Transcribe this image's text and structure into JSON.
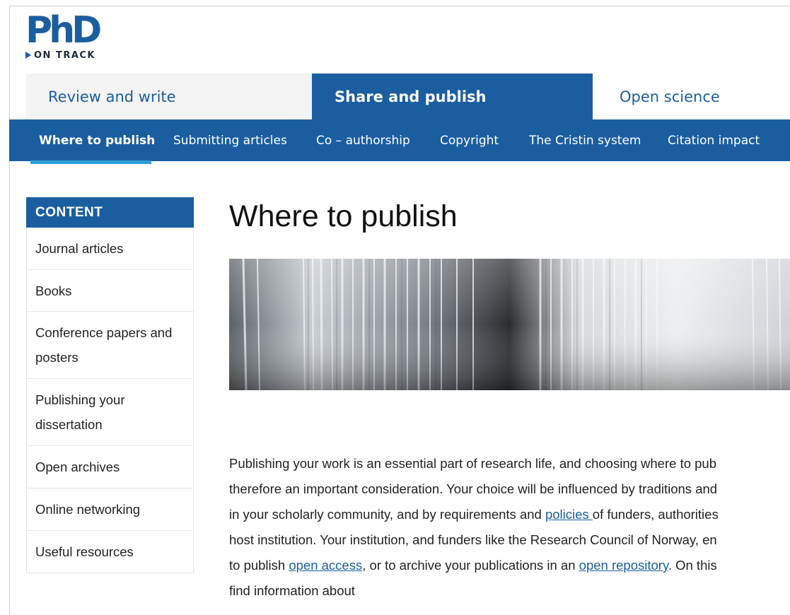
{
  "logo": {
    "main": "PhD",
    "sub": "ON TRACK"
  },
  "top_tabs": [
    {
      "label": "Review and write"
    },
    {
      "label": "Share and publish"
    },
    {
      "label": "Open science"
    }
  ],
  "sub_nav": [
    {
      "label": "Where to publish"
    },
    {
      "label": "Submitting articles"
    },
    {
      "label": "Co – authorship"
    },
    {
      "label": "Copyright"
    },
    {
      "label": "The Cristin system"
    },
    {
      "label": "Citation impact"
    }
  ],
  "sidebar": {
    "heading": "CONTENT",
    "items": [
      {
        "label": "Journal articles"
      },
      {
        "label": "Books"
      },
      {
        "label": "Conference papers and posters"
      },
      {
        "label": "Publishing your dissertation"
      },
      {
        "label": "Open archives"
      },
      {
        "label": "Online networking"
      },
      {
        "label": "Useful resources"
      }
    ]
  },
  "main": {
    "title": "Where to publish",
    "body": {
      "line1": "Publishing your work is an essential part of research life, and choosing where to pub",
      "line2": "therefore an important consideration. Your choice will be influenced by traditions and",
      "line3_pre": "in your scholarly community, and by requirements and ",
      "line3_link": "policies ",
      "line3_post": "of funders, authorities",
      "line4": "host institution. Your institution, and funders like the Research Council of Norway, en",
      "line5_pre": "to publish ",
      "line5_link1": "open access",
      "line5_mid": ", or to archive your publications in an ",
      "line5_link2": "open repository",
      "line5_post": ". On this",
      "line6": "find information about"
    }
  }
}
